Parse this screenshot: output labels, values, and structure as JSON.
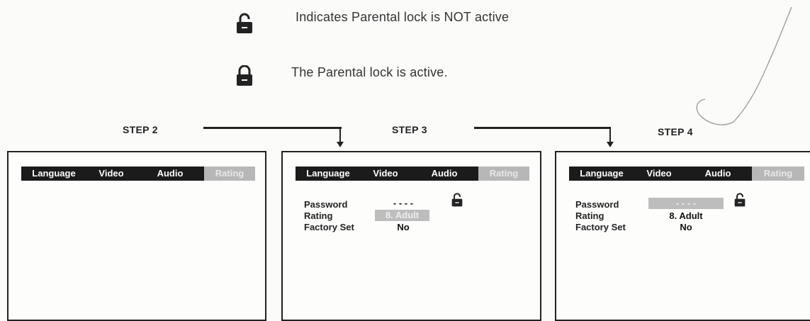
{
  "legend": {
    "unlocked_text": "Indicates Parental lock is NOT active",
    "locked_text": "The Parental lock is active.",
    "unlocked_icon": "unlocked-padlock",
    "locked_icon": "locked-padlock"
  },
  "steps": [
    {
      "label": "STEP 2"
    },
    {
      "label": "STEP 3"
    },
    {
      "label": "STEP 4"
    }
  ],
  "menu": {
    "tabs": [
      "Language",
      "Video",
      "Audio",
      "Rating"
    ],
    "selected": "Rating"
  },
  "settings": {
    "password_label": "Password",
    "rating_label": "Rating",
    "factory_label": "Factory Set",
    "password_value": "- - - -",
    "rating_value": "8. Adult",
    "factory_value": "No"
  },
  "colors": {
    "menu_bar": "#1b1b1b",
    "selected_tab": "#b7b7b7",
    "highlight": "#bdbdbd"
  }
}
